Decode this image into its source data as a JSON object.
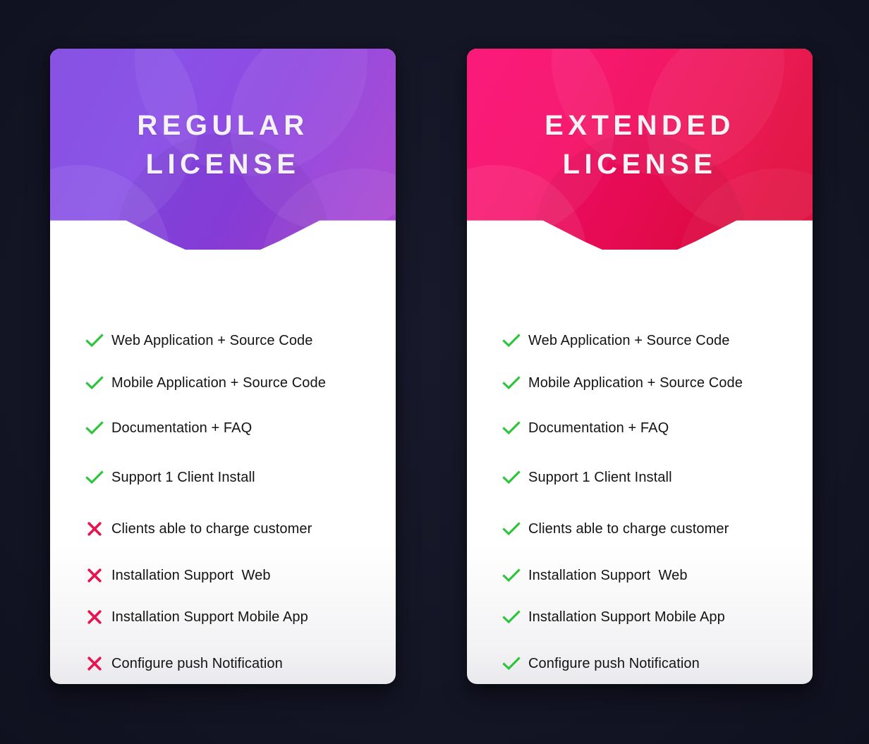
{
  "background_color": "#141626",
  "colors": {
    "check_green": "#2bc53c",
    "cross_pink": "#e8134f",
    "regular_gradient_start": "#7e44e0",
    "regular_gradient_end": "#a93fcf",
    "extended_gradient_start": "#fb0b72",
    "extended_gradient_end": "#dd0a38",
    "card_white": "#ffffff",
    "text_dark": "#141414",
    "title_white": "#f4f2f5"
  },
  "cards": [
    {
      "id": "regular",
      "title_line1": "REGULAR",
      "title_line2": "LICENSE",
      "features": [
        {
          "label": "Web Application + Source Code",
          "icon": "check-icon",
          "included": true
        },
        {
          "label": "Mobile Application + Source Code",
          "icon": "check-icon",
          "included": true
        },
        {
          "label": "Documentation + FAQ",
          "icon": "check-icon",
          "included": true
        },
        {
          "label": "Support 1 Client Install",
          "icon": "check-icon",
          "included": true
        },
        {
          "label": "Clients able to charge customer",
          "icon": "cross-icon",
          "included": false
        },
        {
          "label": "Installation Support  Web",
          "icon": "cross-icon",
          "included": false
        },
        {
          "label": "Installation Support Mobile App",
          "icon": "cross-icon",
          "included": false
        },
        {
          "label": "Configure push Notification",
          "icon": "cross-icon",
          "included": false
        }
      ]
    },
    {
      "id": "extended",
      "title_line1": "EXTENDED",
      "title_line2": "LICENSE",
      "features": [
        {
          "label": "Web Application + Source Code",
          "icon": "check-icon",
          "included": true
        },
        {
          "label": "Mobile Application + Source Code",
          "icon": "check-icon",
          "included": true
        },
        {
          "label": "Documentation + FAQ",
          "icon": "check-icon",
          "included": true
        },
        {
          "label": "Support 1 Client Install",
          "icon": "check-icon",
          "included": true
        },
        {
          "label": "Clients able to charge customer",
          "icon": "check-icon",
          "included": true
        },
        {
          "label": "Installation Support  Web",
          "icon": "check-icon",
          "included": true
        },
        {
          "label": "Installation Support Mobile App",
          "icon": "check-icon",
          "included": true
        },
        {
          "label": "Configure push Notification",
          "icon": "check-icon",
          "included": true
        }
      ]
    }
  ],
  "layout": {
    "feature_row_tops": [
      14,
      74,
      138,
      208,
      281,
      347,
      406,
      472
    ]
  }
}
